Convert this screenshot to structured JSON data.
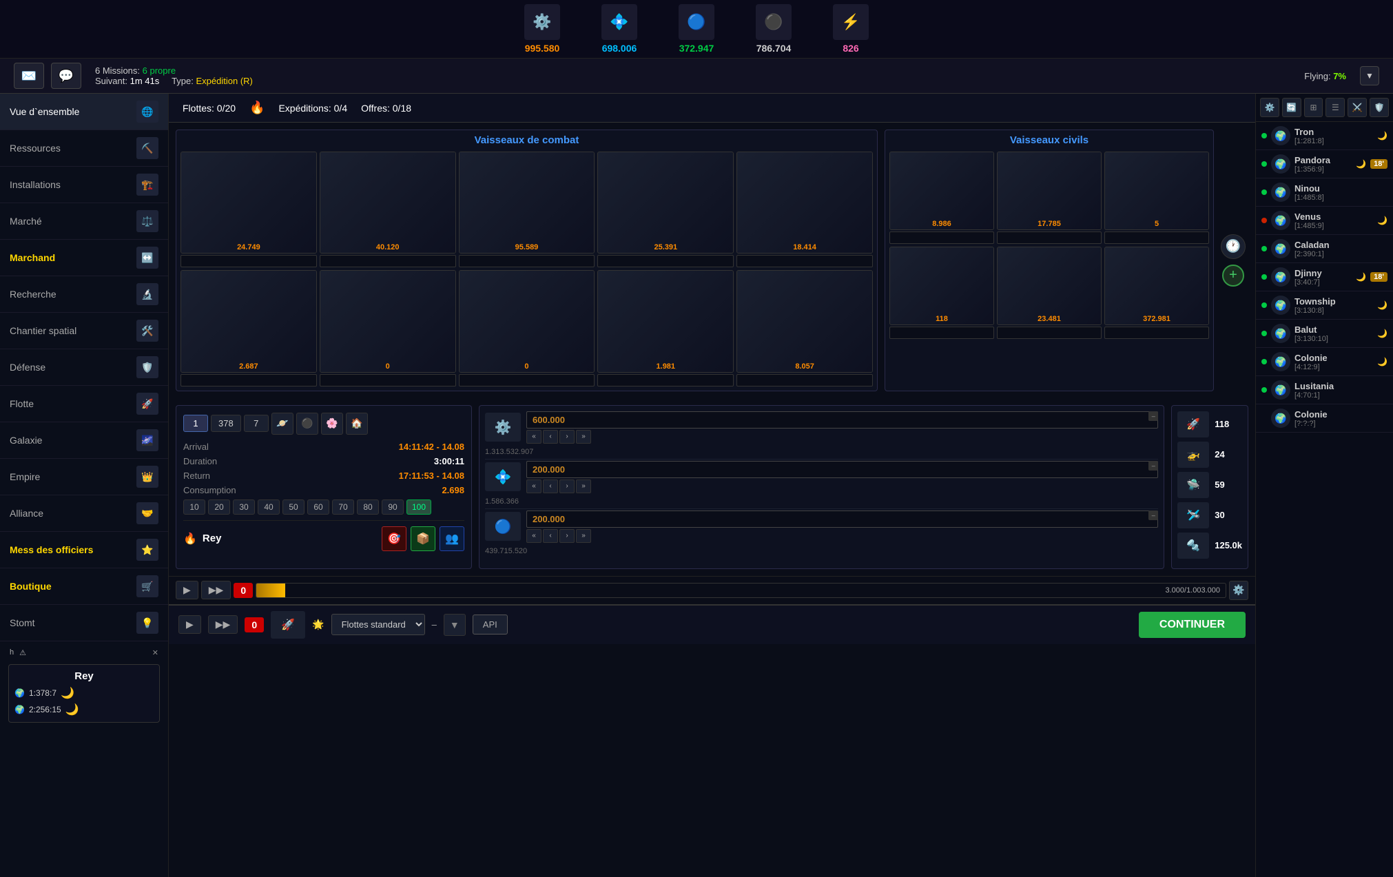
{
  "resources": [
    {
      "icon": "⚙️",
      "value": "995.580",
      "color": "res-orange"
    },
    {
      "icon": "💠",
      "value": "698.006",
      "color": "res-cyan"
    },
    {
      "icon": "🔵",
      "value": "372.947",
      "color": "res-green"
    },
    {
      "icon": "⚫",
      "value": "786.704",
      "color": "res-white"
    },
    {
      "icon": "⚡",
      "value": "826",
      "color": "res-pink"
    }
  ],
  "mission_bar": {
    "missions_count": "6 Missions:",
    "missions_status": "6 propre",
    "next_label": "Suivant:",
    "next_value": "1m 41s",
    "type_label": "Type:",
    "type_value": "Expédition (R)",
    "flying_label": "Flying:",
    "flying_value": "7%"
  },
  "fleet_header": {
    "flottes_label": "Flottes:",
    "flottes_value": "0/20",
    "expeditions_label": "Expéditions:",
    "expeditions_value": "0/4",
    "offres_label": "Offres:",
    "offres_value": "0/18"
  },
  "combat_ships_title": "Vaisseaux de combat",
  "civil_ships_title": "Vaisseaux civils",
  "combat_ships": [
    {
      "value": "24.749"
    },
    {
      "value": "40.120"
    },
    {
      "value": "95.589"
    },
    {
      "value": "25.391"
    },
    {
      "value": "18.414"
    },
    {
      "value": "2.687"
    },
    {
      "value": "0"
    },
    {
      "value": "0"
    },
    {
      "value": "1.981"
    },
    {
      "value": "8.057"
    }
  ],
  "civil_ships": [
    {
      "value": "8.986"
    },
    {
      "value": "17.785"
    },
    {
      "value": "5"
    },
    {
      "value": "118"
    },
    {
      "value": "23.481"
    },
    {
      "value": "372.981"
    }
  ],
  "mission_details": {
    "arrival_label": "Arrival",
    "arrival_value": "14:11:42 - 14.08",
    "duration_label": "Duration",
    "duration_value": "3:00:11",
    "return_label": "Return",
    "return_value": "17:11:53 - 14.08",
    "consumption_label": "Consumption",
    "consumption_value": "2.698",
    "tabs": [
      "1",
      "378",
      "7"
    ],
    "tab_icons": [
      "🪐",
      "⚫",
      "🌸",
      "🏠"
    ],
    "speed_values": [
      "10",
      "20",
      "30",
      "40",
      "50",
      "60",
      "70",
      "80",
      "90",
      "100"
    ],
    "active_speed": "100"
  },
  "target": {
    "name": "Rey"
  },
  "resources_to_send": [
    {
      "icon": "⚙️",
      "amount": "600.000",
      "sub": "1.313.532.907"
    },
    {
      "icon": "💠",
      "amount": "200.000",
      "sub": "1.586.366"
    },
    {
      "icon": "🔵",
      "amount": "200.000",
      "sub": "439.715.520"
    }
  ],
  "cargo_items": [
    {
      "icon": "🚀",
      "count": "118"
    },
    {
      "icon": "🚁",
      "count": "24"
    },
    {
      "icon": "🛸",
      "count": "59"
    },
    {
      "icon": "🛩️",
      "count": "30"
    },
    {
      "icon": "🔩",
      "count": "125.0k"
    }
  ],
  "fleet_progress": {
    "current": "3.000",
    "max": "1.003.000"
  },
  "bottom_bar": {
    "flottes_standard_label": "Flottes standard",
    "api_label": "API",
    "continue_label": "CONTINUER"
  },
  "sidebar_items": [
    {
      "label": "Vue d`ensemble",
      "active": true
    },
    {
      "label": "Ressources"
    },
    {
      "label": "Installations"
    },
    {
      "label": "Marché"
    },
    {
      "label": "Marchand",
      "yellow": true
    },
    {
      "label": "Recherche"
    },
    {
      "label": "Chantier spatial"
    },
    {
      "label": "Défense"
    },
    {
      "label": "Flotte"
    },
    {
      "label": "Galaxie"
    },
    {
      "label": "Empire"
    },
    {
      "label": "Alliance"
    },
    {
      "label": "Mess des officiers",
      "yellow": true
    },
    {
      "label": "Boutique",
      "yellow": true
    },
    {
      "label": "Stomt"
    }
  ],
  "player": {
    "name": "Rey",
    "coords": [
      {
        "coord": "1:378:7",
        "moon": true
      },
      {
        "coord": "2:256:15",
        "moon": true
      }
    ],
    "alerts": [
      "h",
      "⚠"
    ]
  },
  "right_panel": {
    "planets": [
      {
        "name": "Tron",
        "coord": "[1:281:8]",
        "dot": "green",
        "moon": true,
        "badge": null
      },
      {
        "name": "Pandora",
        "coord": "[1:356:9]",
        "dot": "green",
        "moon": true,
        "badge": "18'"
      },
      {
        "name": "Ninou",
        "coord": "[1:485:8]",
        "dot": "green",
        "moon": false,
        "badge": null
      },
      {
        "name": "Venus",
        "coord": "[1:485:9]",
        "dot": "red",
        "moon": true,
        "badge": null
      },
      {
        "name": "Caladan",
        "coord": "[2:390:1]",
        "dot": "green",
        "moon": false,
        "badge": null
      },
      {
        "name": "Djinny",
        "coord": "[3:40:7]",
        "dot": "green",
        "moon": true,
        "badge": "18'"
      },
      {
        "name": "Township",
        "coord": "[3:130:8]",
        "dot": "green",
        "moon": true,
        "badge": null
      },
      {
        "name": "Balut",
        "coord": "[3:130:10]",
        "dot": "green",
        "moon": true,
        "badge": null
      },
      {
        "name": "Colonie",
        "coord": "[4:12:9]",
        "dot": "green",
        "moon": true,
        "badge": null
      },
      {
        "name": "Lusitania",
        "coord": "[4:70:1]",
        "dot": "green",
        "moon": false,
        "badge": null
      },
      {
        "name": "Colonie",
        "coord": "[?:?:?]",
        "dot": "none",
        "moon": false,
        "badge": null
      }
    ]
  }
}
